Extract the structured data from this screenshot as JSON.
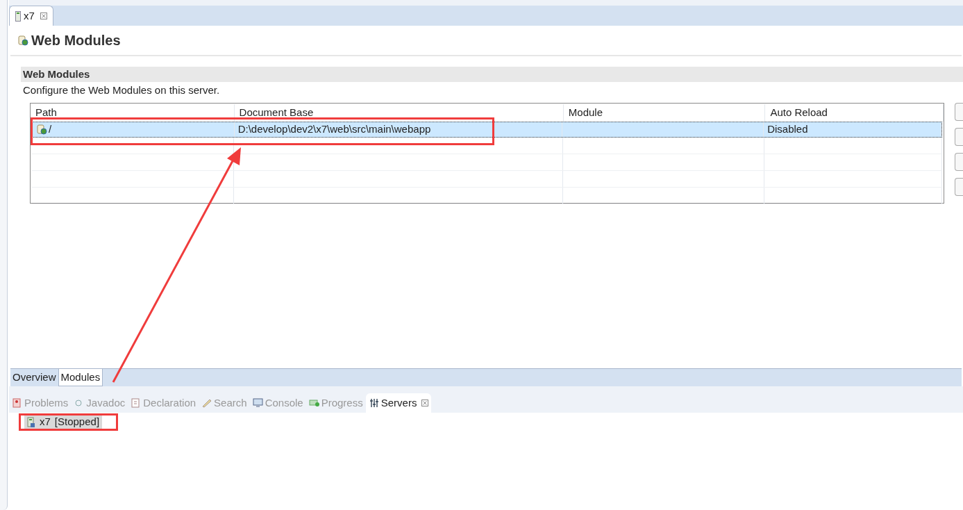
{
  "editor_tab": {
    "label": "x7",
    "selected": true
  },
  "page_title": "Web Modules",
  "section": {
    "title": "Web Modules",
    "description": "Configure the Web Modules on this server."
  },
  "table": {
    "columns": [
      "Path",
      "Document Base",
      "Module",
      "Auto Reload"
    ],
    "rows": [
      {
        "cells": [
          "/",
          "D:\\develop\\dev2\\x7\\web\\src\\main\\webapp",
          "",
          "Disabled"
        ],
        "selected": true
      }
    ]
  },
  "page_tabs": [
    {
      "label": "Overview",
      "selected": false
    },
    {
      "label": "Modules",
      "selected": true
    }
  ],
  "view_tabs": [
    {
      "label": "Problems",
      "selected": false
    },
    {
      "label": "Javadoc",
      "selected": false
    },
    {
      "label": "Declaration",
      "selected": false
    },
    {
      "label": "Search",
      "selected": false
    },
    {
      "label": "Console",
      "selected": false
    },
    {
      "label": "Progress",
      "selected": false
    },
    {
      "label": "Servers",
      "selected": true
    }
  ],
  "servers": [
    {
      "name": "x7",
      "status": "[Stopped]",
      "selected": true
    }
  ]
}
